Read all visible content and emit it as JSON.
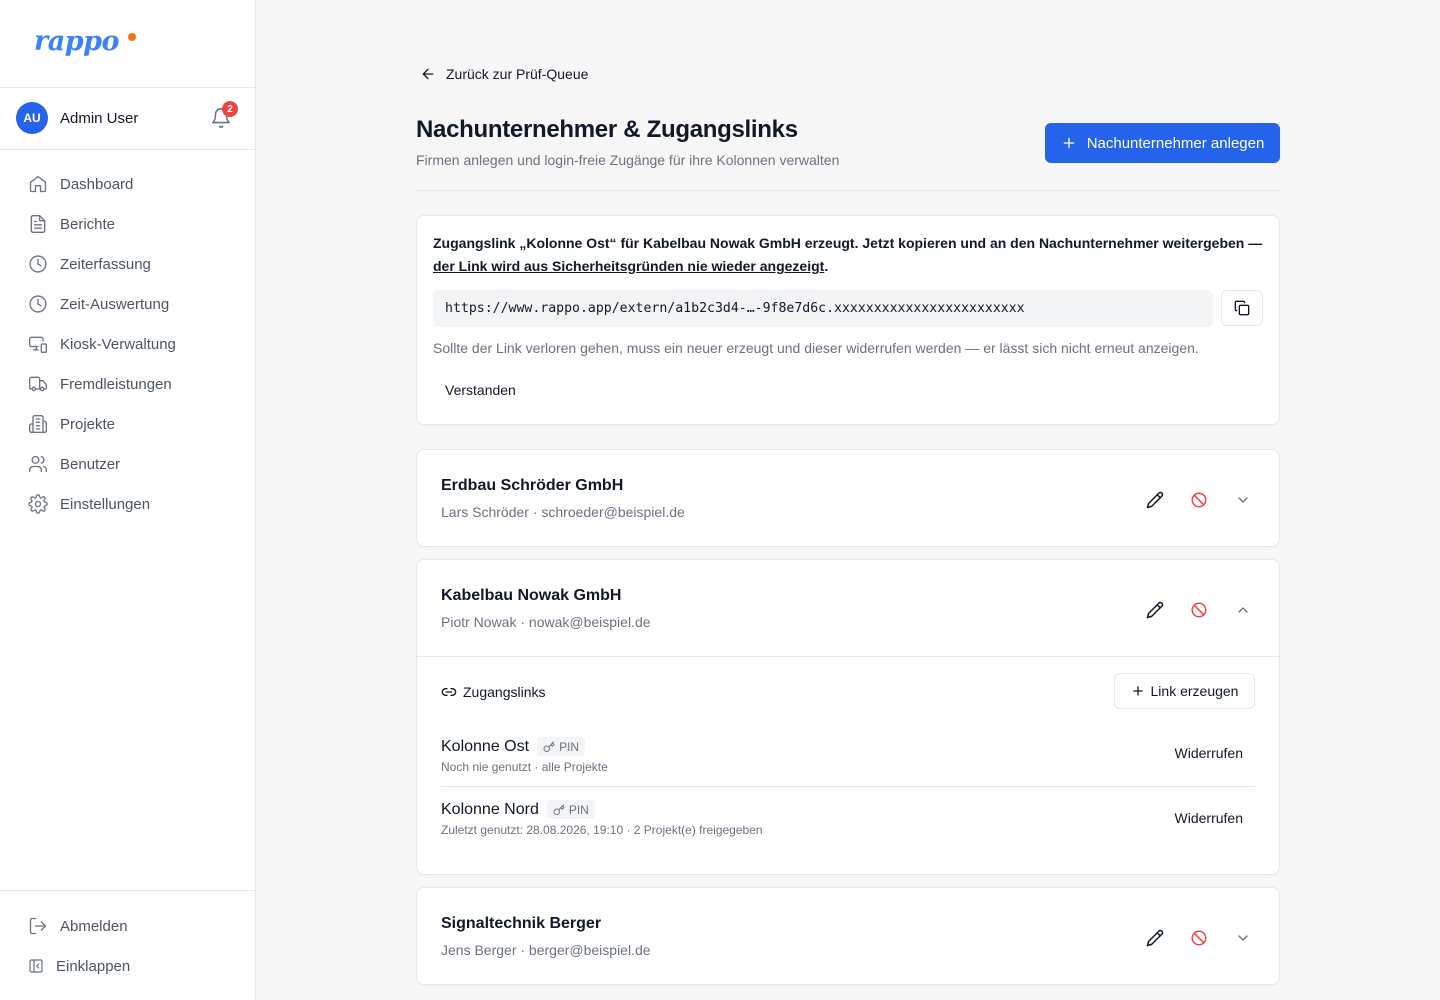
{
  "app": {
    "logo_text": "rappo",
    "colors": {
      "primary": "#2563eb",
      "danger": "#ef4444",
      "logo_dot": "#f97316"
    }
  },
  "sidebar": {
    "user": {
      "initials": "AU",
      "name": "Admin User",
      "notifications": "2"
    },
    "items": [
      {
        "label": "Dashboard",
        "icon": "home-icon"
      },
      {
        "label": "Berichte",
        "icon": "file-text-icon"
      },
      {
        "label": "Zeiterfassung",
        "icon": "clock-icon"
      },
      {
        "label": "Zeit-Auswertung",
        "icon": "clock-icon"
      },
      {
        "label": "Kiosk-Verwaltung",
        "icon": "devices-icon"
      },
      {
        "label": "Fremdleistungen",
        "icon": "truck-icon"
      },
      {
        "label": "Projekte",
        "icon": "building-icon"
      },
      {
        "label": "Benutzer",
        "icon": "users-icon"
      },
      {
        "label": "Einstellungen",
        "icon": "gear-icon"
      }
    ],
    "bottom": {
      "logout": "Abmelden",
      "collapse": "Einklappen"
    }
  },
  "header": {
    "back_label": "Zurück zur Prüf-Queue",
    "title": "Nachunternehmer & Zugangslinks",
    "subtitle": "Firmen anlegen und login-freie Zugänge für ihre Kolonnen verwalten",
    "create_button": "Nachunternehmer anlegen"
  },
  "alert": {
    "message_part1": "Zugangslink „Kolonne Ost“ für Kabelbau Nowak GmbH erzeugt. Jetzt kopieren und an den Nachunternehmer weitergeben — ",
    "message_underlined": "der Link wird aus Sicherheitsgründen nie wieder angezeigt",
    "message_end": ".",
    "link": "https://www.rappo.app/extern/a1b2c3d4-…-9f8e7d6c.xxxxxxxxxxxxxxxxxxxxxxxx",
    "note": "Sollte der Link verloren gehen, muss ein neuer erzeugt und dieser widerrufen werden — er lässt sich nicht erneut anzeigen.",
    "confirm_button": "Verstanden"
  },
  "companies": [
    {
      "name": "Erdbau Schröder GmbH",
      "contact": "Lars Schröder · schroeder@beispiel.de"
    },
    {
      "name": "Kabelbau Nowak GmbH",
      "contact": "Piotr Nowak · nowak@beispiel.de",
      "links_heading": "Zugangslinks",
      "create_link_button": "Link erzeugen",
      "links": [
        {
          "name": "Kolonne Ost",
          "badge": "PIN",
          "meta": "Noch nie genutzt · alle Projekte",
          "action": "Widerrufen"
        },
        {
          "name": "Kolonne Nord",
          "badge": "PIN",
          "meta": "Zuletzt genutzt: 28.08.2026, 19:10 · 2 Projekt(e) freigegeben",
          "action": "Widerrufen"
        }
      ]
    },
    {
      "name": "Signaltechnik Berger",
      "contact": "Jens Berger · berger@beispiel.de"
    }
  ]
}
